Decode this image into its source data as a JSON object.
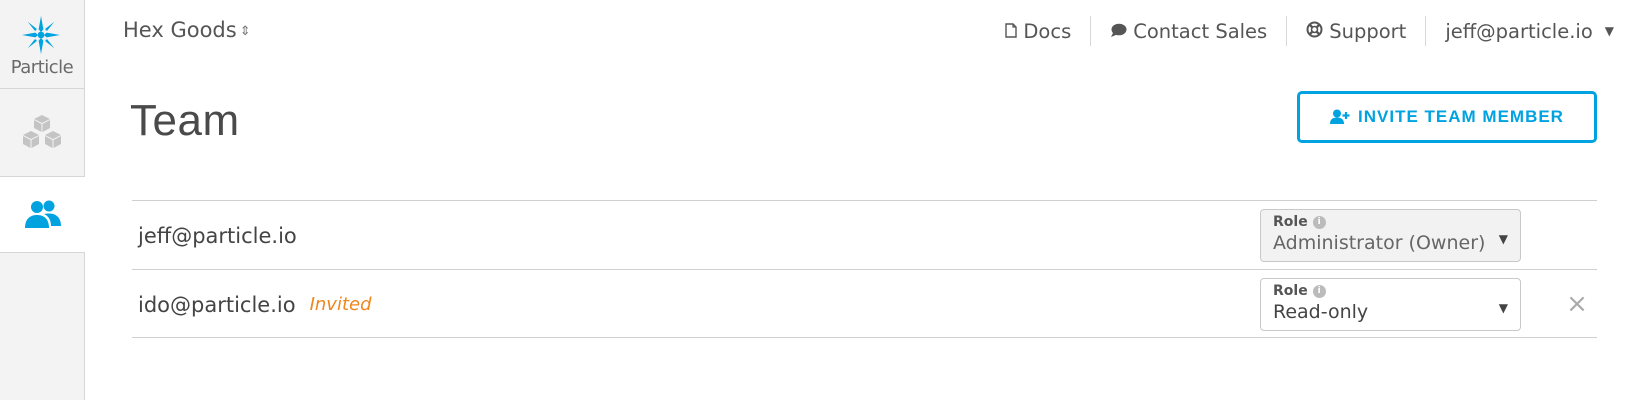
{
  "sidebar": {
    "logo_text": "Particle",
    "items": [
      {
        "name": "products",
        "icon": "cubes-icon"
      },
      {
        "name": "team",
        "icon": "team-icon",
        "active": true
      }
    ]
  },
  "header": {
    "org_name": "Hex Goods",
    "org_caret": "⌃⌄",
    "links": [
      {
        "label": "Docs",
        "icon": "document-icon"
      },
      {
        "label": "Contact Sales",
        "icon": "chat-icon"
      },
      {
        "label": "Support",
        "icon": "lifebuoy-icon"
      }
    ],
    "user": "jeff@particle.io"
  },
  "main": {
    "title": "Team",
    "invite_label": "INVITE TEAM MEMBER",
    "members": [
      {
        "email": "jeff@particle.io",
        "status": "",
        "role_label": "Role",
        "role": "Administrator (Owner)",
        "disabled": true
      },
      {
        "email": "ido@particle.io",
        "status": "Invited",
        "role_label": "Role",
        "role": "Read-only",
        "disabled": false,
        "remove": "×"
      }
    ]
  },
  "colors": {
    "accent": "#00a3e0",
    "invited": "#f0861e",
    "sidebar_bg": "#f3f3f3"
  }
}
